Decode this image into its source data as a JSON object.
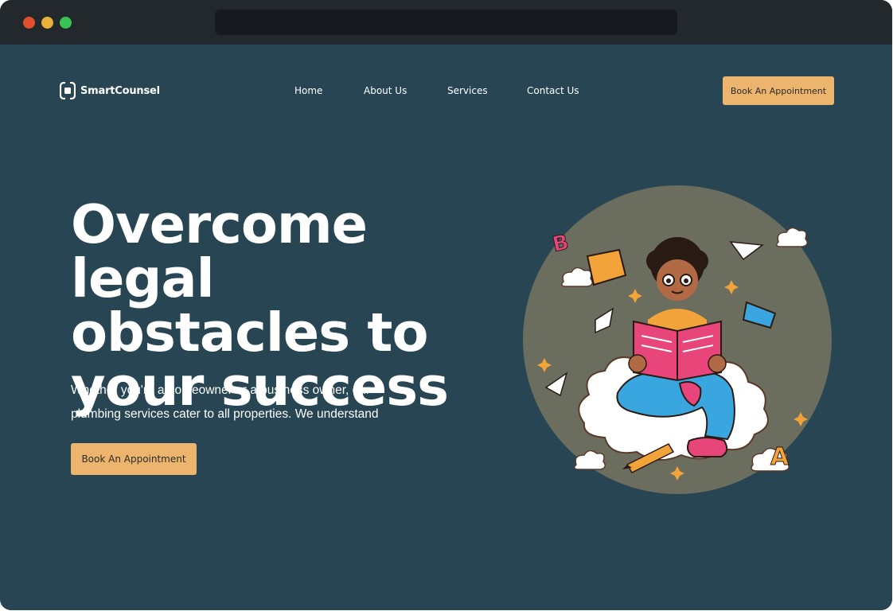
{
  "brand": {
    "name": "SmartCounsel",
    "icon": "logo-icon"
  },
  "nav": {
    "items": [
      {
        "label": "Home"
      },
      {
        "label": "About Us"
      },
      {
        "label": "Services"
      },
      {
        "label": "Contact Us"
      }
    ],
    "cta_label": "Book An Appointment"
  },
  "hero": {
    "title_lines": [
      "Overcome legal",
      "obstacles to",
      "your success"
    ],
    "subtitle_lines": [
      "Whether you're a homeowner or a business owner, our",
      "plumbing services cater to all properties. We understand"
    ],
    "cta_label": "Book An Appointment",
    "illustration": {
      "icon": "child-reading-book-illustration",
      "letters": [
        "B",
        "A"
      ]
    }
  },
  "colors": {
    "page_bg": "#274552",
    "accent": "#ecb46c",
    "titlebar": "#23282d",
    "illustration_circle": "#6b6e5e"
  }
}
